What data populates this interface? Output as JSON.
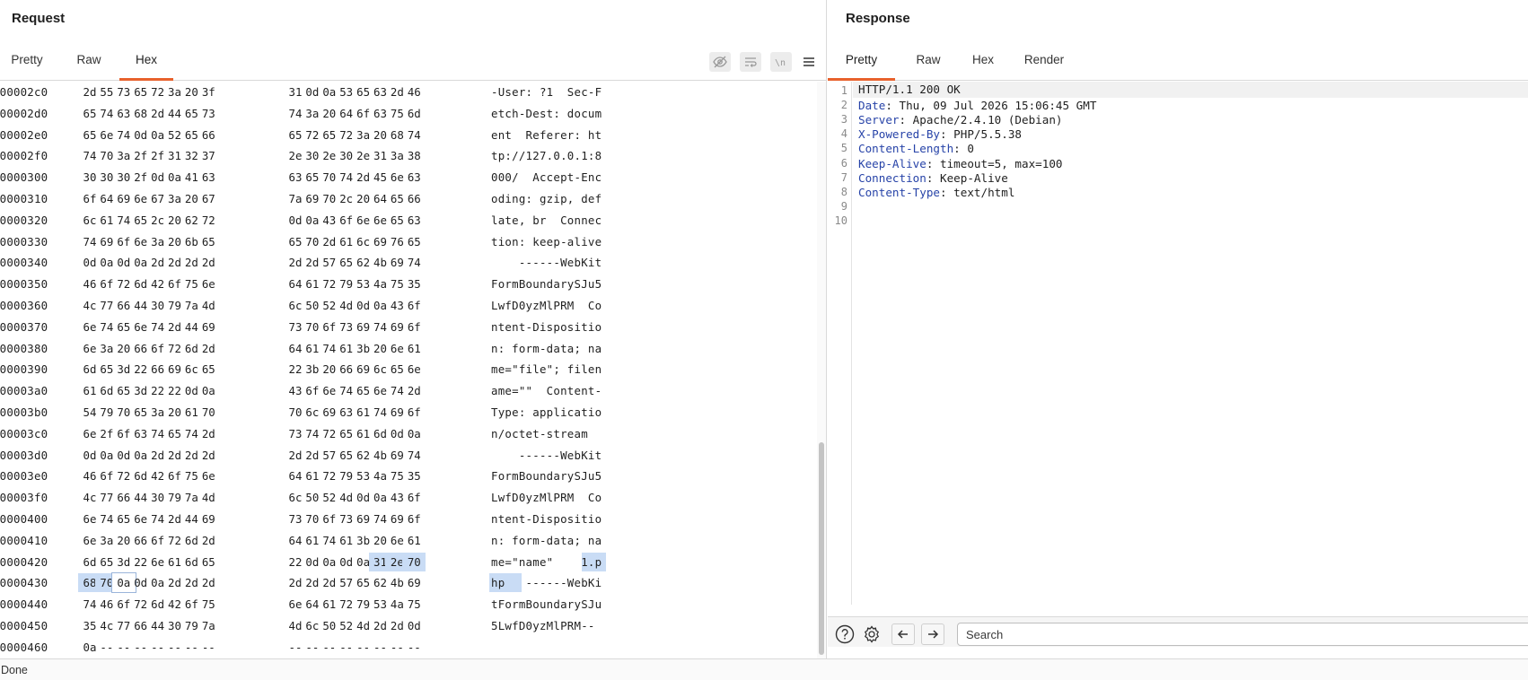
{
  "request": {
    "title": "Request",
    "tabs": [
      "Pretty",
      "Raw",
      "Hex"
    ],
    "active_tab": "Hex",
    "toolbar_icons": [
      "hide-nonprintable-icon",
      "wrap-lines-icon",
      "newline-icon",
      "menu-icon"
    ],
    "hex_rows": [
      {
        "offset": "000002c0",
        "bytes": [
          "2d",
          "55",
          "73",
          "65",
          "72",
          "3a",
          "20",
          "3f",
          "31",
          "0d",
          "0a",
          "53",
          "65",
          "63",
          "2d",
          "46"
        ],
        "ascii": "-User: ?1  Sec-F"
      },
      {
        "offset": "000002d0",
        "bytes": [
          "65",
          "74",
          "63",
          "68",
          "2d",
          "44",
          "65",
          "73",
          "74",
          "3a",
          "20",
          "64",
          "6f",
          "63",
          "75",
          "6d"
        ],
        "ascii": "etch-Dest: docum"
      },
      {
        "offset": "000002e0",
        "bytes": [
          "65",
          "6e",
          "74",
          "0d",
          "0a",
          "52",
          "65",
          "66",
          "65",
          "72",
          "65",
          "72",
          "3a",
          "20",
          "68",
          "74"
        ],
        "ascii": "ent  Referer: ht"
      },
      {
        "offset": "000002f0",
        "bytes": [
          "74",
          "70",
          "3a",
          "2f",
          "2f",
          "31",
          "32",
          "37",
          "2e",
          "30",
          "2e",
          "30",
          "2e",
          "31",
          "3a",
          "38"
        ],
        "ascii": "tp://127.0.0.1:8"
      },
      {
        "offset": "00000300",
        "bytes": [
          "30",
          "30",
          "30",
          "2f",
          "0d",
          "0a",
          "41",
          "63",
          "63",
          "65",
          "70",
          "74",
          "2d",
          "45",
          "6e",
          "63"
        ],
        "ascii": "000/  Accept-Enc"
      },
      {
        "offset": "00000310",
        "bytes": [
          "6f",
          "64",
          "69",
          "6e",
          "67",
          "3a",
          "20",
          "67",
          "7a",
          "69",
          "70",
          "2c",
          "20",
          "64",
          "65",
          "66"
        ],
        "ascii": "oding: gzip, def"
      },
      {
        "offset": "00000320",
        "bytes": [
          "6c",
          "61",
          "74",
          "65",
          "2c",
          "20",
          "62",
          "72",
          "0d",
          "0a",
          "43",
          "6f",
          "6e",
          "6e",
          "65",
          "63"
        ],
        "ascii": "late, br  Connec"
      },
      {
        "offset": "00000330",
        "bytes": [
          "74",
          "69",
          "6f",
          "6e",
          "3a",
          "20",
          "6b",
          "65",
          "65",
          "70",
          "2d",
          "61",
          "6c",
          "69",
          "76",
          "65"
        ],
        "ascii": "tion: keep-alive"
      },
      {
        "offset": "00000340",
        "bytes": [
          "0d",
          "0a",
          "0d",
          "0a",
          "2d",
          "2d",
          "2d",
          "2d",
          "2d",
          "2d",
          "57",
          "65",
          "62",
          "4b",
          "69",
          "74"
        ],
        "ascii": "    ------WebKit"
      },
      {
        "offset": "00000350",
        "bytes": [
          "46",
          "6f",
          "72",
          "6d",
          "42",
          "6f",
          "75",
          "6e",
          "64",
          "61",
          "72",
          "79",
          "53",
          "4a",
          "75",
          "35"
        ],
        "ascii": "FormBoundarySJu5"
      },
      {
        "offset": "00000360",
        "bytes": [
          "4c",
          "77",
          "66",
          "44",
          "30",
          "79",
          "7a",
          "4d",
          "6c",
          "50",
          "52",
          "4d",
          "0d",
          "0a",
          "43",
          "6f"
        ],
        "ascii": "LwfD0yzMlPRM  Co"
      },
      {
        "offset": "00000370",
        "bytes": [
          "6e",
          "74",
          "65",
          "6e",
          "74",
          "2d",
          "44",
          "69",
          "73",
          "70",
          "6f",
          "73",
          "69",
          "74",
          "69",
          "6f"
        ],
        "ascii": "ntent-Dispositio"
      },
      {
        "offset": "00000380",
        "bytes": [
          "6e",
          "3a",
          "20",
          "66",
          "6f",
          "72",
          "6d",
          "2d",
          "64",
          "61",
          "74",
          "61",
          "3b",
          "20",
          "6e",
          "61"
        ],
        "ascii": "n: form-data; na"
      },
      {
        "offset": "00000390",
        "bytes": [
          "6d",
          "65",
          "3d",
          "22",
          "66",
          "69",
          "6c",
          "65",
          "22",
          "3b",
          "20",
          "66",
          "69",
          "6c",
          "65",
          "6e"
        ],
        "ascii": "me=\"file\"; filen"
      },
      {
        "offset": "000003a0",
        "bytes": [
          "61",
          "6d",
          "65",
          "3d",
          "22",
          "22",
          "0d",
          "0a",
          "43",
          "6f",
          "6e",
          "74",
          "65",
          "6e",
          "74",
          "2d"
        ],
        "ascii": "ame=\"\"  Content-"
      },
      {
        "offset": "000003b0",
        "bytes": [
          "54",
          "79",
          "70",
          "65",
          "3a",
          "20",
          "61",
          "70",
          "70",
          "6c",
          "69",
          "63",
          "61",
          "74",
          "69",
          "6f"
        ],
        "ascii": "Type: applicatio"
      },
      {
        "offset": "000003c0",
        "bytes": [
          "6e",
          "2f",
          "6f",
          "63",
          "74",
          "65",
          "74",
          "2d",
          "73",
          "74",
          "72",
          "65",
          "61",
          "6d",
          "0d",
          "0a"
        ],
        "ascii": "n/octet-stream  "
      },
      {
        "offset": "000003d0",
        "bytes": [
          "0d",
          "0a",
          "0d",
          "0a",
          "2d",
          "2d",
          "2d",
          "2d",
          "2d",
          "2d",
          "57",
          "65",
          "62",
          "4b",
          "69",
          "74"
        ],
        "ascii": "    ------WebKit"
      },
      {
        "offset": "000003e0",
        "bytes": [
          "46",
          "6f",
          "72",
          "6d",
          "42",
          "6f",
          "75",
          "6e",
          "64",
          "61",
          "72",
          "79",
          "53",
          "4a",
          "75",
          "35"
        ],
        "ascii": "FormBoundarySJu5"
      },
      {
        "offset": "000003f0",
        "bytes": [
          "4c",
          "77",
          "66",
          "44",
          "30",
          "79",
          "7a",
          "4d",
          "6c",
          "50",
          "52",
          "4d",
          "0d",
          "0a",
          "43",
          "6f"
        ],
        "ascii": "LwfD0yzMlPRM  Co"
      },
      {
        "offset": "00000400",
        "bytes": [
          "6e",
          "74",
          "65",
          "6e",
          "74",
          "2d",
          "44",
          "69",
          "73",
          "70",
          "6f",
          "73",
          "69",
          "74",
          "69",
          "6f"
        ],
        "ascii": "ntent-Dispositio"
      },
      {
        "offset": "00000410",
        "bytes": [
          "6e",
          "3a",
          "20",
          "66",
          "6f",
          "72",
          "6d",
          "2d",
          "64",
          "61",
          "74",
          "61",
          "3b",
          "20",
          "6e",
          "61"
        ],
        "ascii": "n: form-data; na"
      },
      {
        "offset": "00000420",
        "bytes": [
          "6d",
          "65",
          "3d",
          "22",
          "6e",
          "61",
          "6d",
          "65",
          "22",
          "0d",
          "0a",
          "0d",
          "0a",
          "31",
          "2e",
          "70"
        ],
        "ascii": "me=\"name\"    1.p",
        "selected_from": 13
      },
      {
        "offset": "00000430",
        "bytes": [
          "68",
          "70",
          "0a",
          "0d",
          "0a",
          "2d",
          "2d",
          "2d",
          "2d",
          "2d",
          "2d",
          "57",
          "65",
          "62",
          "4b",
          "69"
        ],
        "ascii": "hp   ------WebKi",
        "selected_to": 1,
        "cursor": 2
      },
      {
        "offset": "00000440",
        "bytes": [
          "74",
          "46",
          "6f",
          "72",
          "6d",
          "42",
          "6f",
          "75",
          "6e",
          "64",
          "61",
          "72",
          "79",
          "53",
          "4a",
          "75"
        ],
        "ascii": "tFormBoundarySJu"
      },
      {
        "offset": "00000450",
        "bytes": [
          "35",
          "4c",
          "77",
          "66",
          "44",
          "30",
          "79",
          "7a",
          "4d",
          "6c",
          "50",
          "52",
          "4d",
          "2d",
          "2d",
          "0d"
        ],
        "ascii": "5LwfD0yzMlPRM--"
      },
      {
        "offset": "00000460",
        "bytes": [
          "0a",
          "--",
          "--",
          "--",
          "--",
          "--",
          "--",
          "--",
          "--",
          "--",
          "--",
          "--",
          "--",
          "--",
          "--",
          "--"
        ],
        "ascii": ""
      }
    ]
  },
  "response": {
    "title": "Response",
    "tabs": [
      "Pretty",
      "Raw",
      "Hex",
      "Render"
    ],
    "active_tab": "Pretty",
    "lines": [
      {
        "num": "1",
        "text": "HTTP/1.1 200 OK"
      },
      {
        "num": "2",
        "key": "Date",
        "value": " Thu, 09 Jul 2026 15:06:45 GMT"
      },
      {
        "num": "3",
        "key": "Server",
        "value": " Apache/2.4.10 (Debian)"
      },
      {
        "num": "4",
        "key": "X-Powered-By",
        "value": " PHP/5.5.38"
      },
      {
        "num": "5",
        "key": "Content-Length",
        "value": " 0"
      },
      {
        "num": "6",
        "key": "Keep-Alive",
        "value": " timeout=5, max=100"
      },
      {
        "num": "7",
        "key": "Connection",
        "value": " Keep-Alive"
      },
      {
        "num": "8",
        "key": "Content-Type",
        "value": " text/html"
      },
      {
        "num": "9",
        "text": ""
      },
      {
        "num": "10",
        "text": ""
      }
    ],
    "search": {
      "placeholder": "Search",
      "value": ""
    },
    "icons": [
      "help-icon",
      "settings-icon",
      "back-arrow-icon",
      "forward-arrow-icon"
    ]
  },
  "status": {
    "text": "Done"
  },
  "colors": {
    "accent": "#e8612c",
    "selection": "#c9dcf5",
    "header_key": "#2743a8"
  }
}
